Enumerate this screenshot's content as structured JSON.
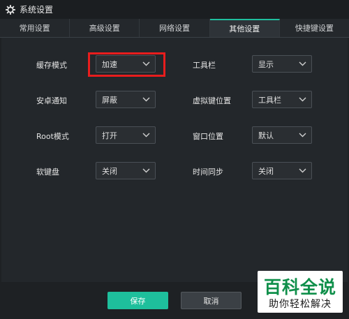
{
  "window": {
    "title": "系统设置"
  },
  "tabs": [
    {
      "label": "常用设置",
      "active": false
    },
    {
      "label": "高级设置",
      "active": false
    },
    {
      "label": "网络设置",
      "active": false
    },
    {
      "label": "其他设置",
      "active": true
    },
    {
      "label": "快捷键设置",
      "active": false
    }
  ],
  "settings": {
    "left": [
      {
        "label": "缓存模式",
        "value": "加速"
      },
      {
        "label": "安卓通知",
        "value": "屏蔽"
      },
      {
        "label": "Root模式",
        "value": "打开"
      },
      {
        "label": "软键盘",
        "value": "关闭"
      }
    ],
    "right": [
      {
        "label": "工具栏",
        "value": "显示"
      },
      {
        "label": "虚拟键位置",
        "value": "工具栏"
      },
      {
        "label": "窗口位置",
        "value": "默认"
      },
      {
        "label": "时间同步",
        "value": "关闭"
      }
    ]
  },
  "footer": {
    "save_label": "保存",
    "cancel_label": "取消"
  },
  "watermark": {
    "main": "百科全说",
    "sub": "助你轻松解决"
  },
  "colors": {
    "accent": "#1ebf9c",
    "highlight": "#e81d1d",
    "background": "#23272b"
  }
}
